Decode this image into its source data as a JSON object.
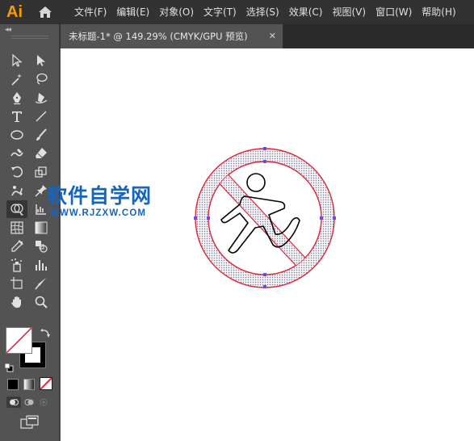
{
  "app": {
    "logo_text": "Ai"
  },
  "menu": {
    "items": [
      "文件(F)",
      "编辑(E)",
      "对象(O)",
      "文字(T)",
      "选择(S)",
      "效果(C)",
      "视图(V)",
      "窗口(W)",
      "帮助(H)"
    ]
  },
  "document_tab": {
    "title": "未标题-1* @ 149.29% (CMYK/GPU 预览)",
    "close_glyph": "✕"
  },
  "toolbar": {
    "collapse_glyph": "◂◂",
    "tools": [
      "selection-tool-icon",
      "direct-selection-tool-icon",
      "magic-wand-tool-icon",
      "lasso-tool-icon",
      "pen-tool-icon",
      "curvature-tool-icon",
      "type-tool-icon",
      "line-segment-tool-icon",
      "ellipse-tool-icon",
      "paintbrush-tool-icon",
      "shaper-tool-icon",
      "eraser-tool-icon",
      "rotate-tool-icon",
      "scale-tool-icon",
      "puppet-warp-tool-icon",
      "pin-tool-icon",
      "shape-builder-tool-icon",
      "graph-tool-icon",
      "mesh-tool-icon",
      "gradient-tool-icon",
      "eyedropper-tool-icon",
      "blend-tool-icon",
      "symbol-sprayer-tool-icon",
      "column-graph-tool-icon",
      "artboard-tool-icon",
      "slice-tool-icon",
      "hand-tool-icon",
      "zoom-tool-icon"
    ],
    "fill_color": "none",
    "stroke_color": "#000000"
  },
  "colors": {
    "accent_orange": "#ff9a00",
    "menubar_bg": "#323232",
    "panel_bg": "#535353",
    "sign_red": "#e0263a",
    "selection_blue": "#3a5bd9",
    "watermark_blue": "#1565c0"
  },
  "watermark": {
    "title": "软件自学网",
    "url": "WWW.RJZXW.COM"
  }
}
